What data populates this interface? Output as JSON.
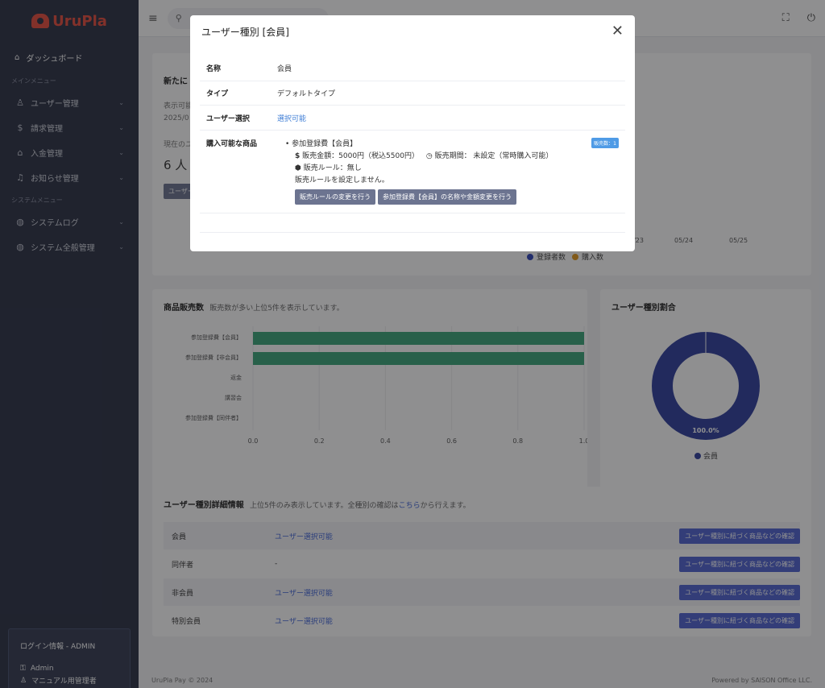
{
  "app": {
    "logo_text": "UruPla"
  },
  "sidebar": {
    "dashboard": "ダッシュボード",
    "main_menu_label": "メインメニュー",
    "main_items": [
      {
        "label": "ユーザー管理",
        "icon": "user-icon"
      },
      {
        "label": "請求管理",
        "icon": "dollar-icon"
      },
      {
        "label": "入金管理",
        "icon": "bank-icon"
      },
      {
        "label": "お知らせ管理",
        "icon": "bell-icon"
      }
    ],
    "system_menu_label": "システムメニュー",
    "system_items": [
      {
        "label": "システムログ",
        "icon": "globe-icon"
      },
      {
        "label": "システム全般管理",
        "icon": "globe-icon"
      }
    ],
    "login": {
      "title": "ログイン情報 - ADMIN",
      "user": "Admin",
      "role": "マニュアル用管理者"
    }
  },
  "top_card": {
    "title": "新たに",
    "text1": "表示可能",
    "text2": "2025/0",
    "text3": "現在のユ",
    "count": "6 人",
    "button": "ユーザー",
    "x_ticks": [
      "5/23",
      "05/24",
      "05/25"
    ],
    "legend": [
      {
        "name": "登録者数",
        "color": "#2f44b8"
      },
      {
        "name": "購入数",
        "color": "#e59a1e"
      }
    ]
  },
  "sales_card": {
    "title": "商品販売数",
    "subtitle": "販売数が多い上位5件を表示しています。"
  },
  "chart_data": [
    {
      "type": "bar",
      "orientation": "horizontal",
      "title": "商品販売数",
      "categories": [
        "参加登録費【会員】",
        "参加登録費【非会員】",
        "返金",
        "講習会",
        "参加登録費【同伴者】"
      ],
      "values": [
        1,
        1,
        0,
        0,
        0
      ],
      "xlim": [
        0,
        1
      ],
      "x_ticks": [
        "0.0",
        "0.2",
        "0.4",
        "0.6",
        "0.8",
        "1.0"
      ],
      "bar_color": "#3aa57a"
    },
    {
      "type": "pie",
      "title": "ユーザー種別割合",
      "labels": [
        "会員"
      ],
      "values": [
        100.0
      ],
      "value_label": "100.0%",
      "colors": [
        "#2f3f9e"
      ]
    }
  ],
  "usertype_detail": {
    "title": "ユーザー種別詳細情報",
    "subtitle_pre": "上位5件のみ表示しています。全種別の確認は",
    "subtitle_link": "こちら",
    "subtitle_post": "から行えます。",
    "rows": [
      {
        "name": "会員",
        "value": "ユーザー選択可能",
        "button": "ユーザー種別に紐づく商品などの確認"
      },
      {
        "name": "同伴者",
        "value": "-",
        "button": "ユーザー種別に紐づく商品などの確認"
      },
      {
        "name": "非会員",
        "value": "ユーザー選択可能",
        "button": "ユーザー種別に紐づく商品などの確認"
      },
      {
        "name": "特別会員",
        "value": "ユーザー選択可能",
        "button": "ユーザー種別に紐づく商品などの確認"
      }
    ]
  },
  "footer": {
    "left": "UruPla Pay © 2024",
    "right": "Powered by SAISON Office LLC."
  },
  "modal": {
    "title": "ユーザー種別 [会員]",
    "name_key": "名称",
    "name_val": "会員",
    "type_key": "タイプ",
    "type_val": "デフォルトタイプ",
    "select_key": "ユーザー選択",
    "select_val": "選択可能",
    "products_key": "購入可能な商品",
    "product": {
      "name": "参加登録費【会員】",
      "price": "販売金額：5000円（税込5500円）",
      "period": "販売期間： 未設定（常時購入可能）",
      "rule": "販売ルール：無し",
      "rule_note": "販売ルールを設定しません。",
      "btn_rule": "販売ルールの変更を行う",
      "btn_edit": "参加登録費【会員】の名称や金額変更を行う",
      "badge": "販売数：1"
    }
  }
}
